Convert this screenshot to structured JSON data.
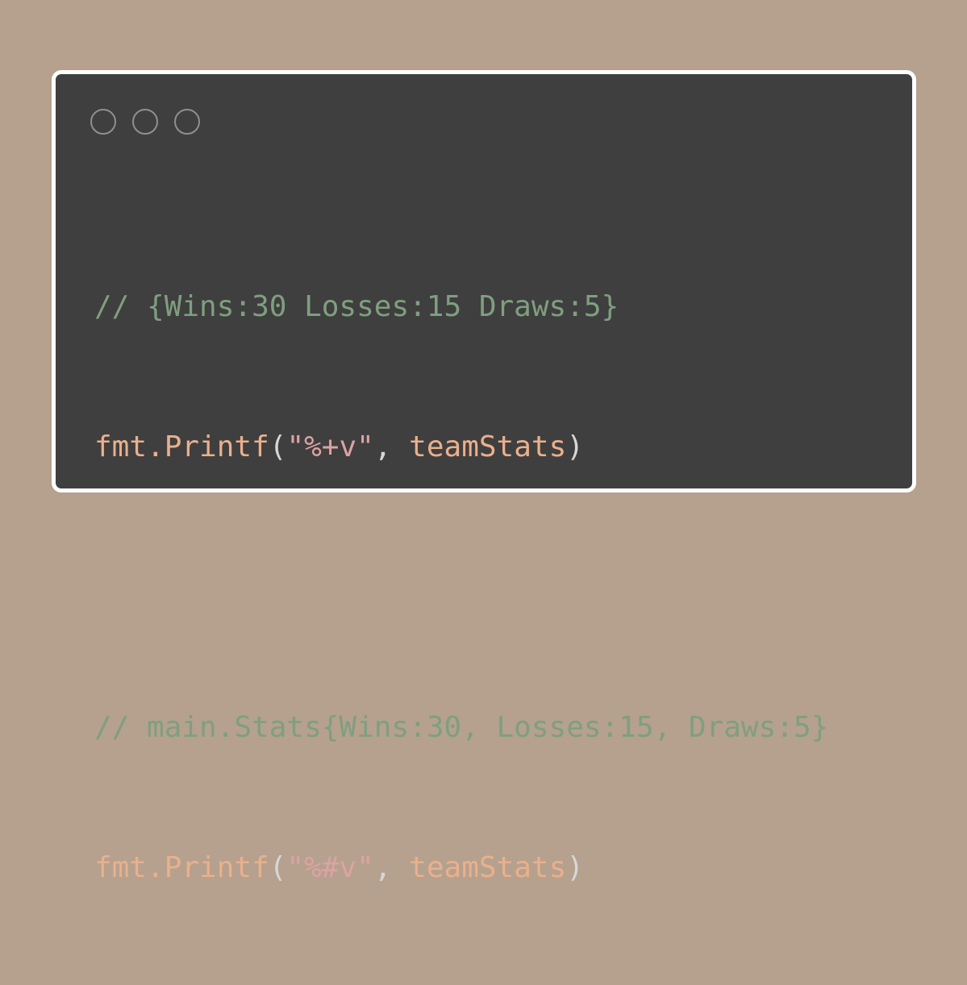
{
  "window_controls": [
    {
      "name": "close"
    },
    {
      "name": "minimize"
    },
    {
      "name": "maximize"
    }
  ],
  "code": {
    "line1_comment": "// {Wins:30 Losses:15 Draws:5}",
    "line2": {
      "func": "fmt.Printf",
      "open": "(",
      "string": "\"%+v\"",
      "sep": ", ",
      "arg": "teamStats",
      "close": ")"
    },
    "line4_comment": "// main.Stats{Wins:30, Losses:15, Draws:5}",
    "line5": {
      "func": "fmt.Printf",
      "open": "(",
      "string": "\"%#v\"",
      "sep": ", ",
      "arg": "teamStats",
      "close": ")"
    }
  },
  "colors": {
    "background": "#b5a18e",
    "window": "#3f3f3f",
    "border": "#ffffff",
    "comment": "#7f9f7f",
    "identifier": "#eab08c",
    "string": "#dca3a3"
  }
}
